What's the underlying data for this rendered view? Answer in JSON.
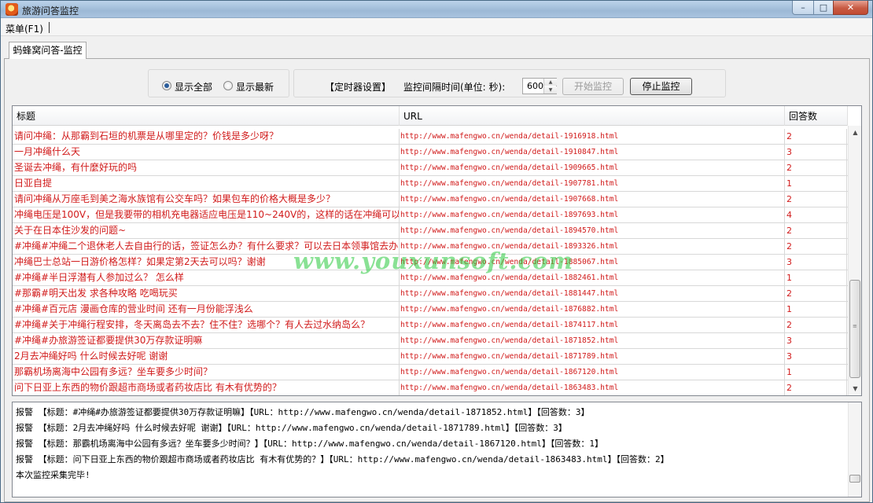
{
  "window": {
    "title": "旅游问答监控",
    "buttons": {
      "minimize": "–",
      "maximize": "□",
      "close": "✕"
    }
  },
  "menu": {
    "items": [
      {
        "label": "菜单(F1)"
      }
    ]
  },
  "tabs": [
    {
      "label": "蚂蜂窝问答-监控",
      "active": true
    }
  ],
  "controls": {
    "display_mode": {
      "options": [
        {
          "label": "显示全部",
          "checked": true
        },
        {
          "label": "显示最新",
          "checked": false
        }
      ]
    },
    "timer_label": "【定时器设置】",
    "interval_label": "监控间隔时间(单位: 秒):",
    "interval_value": "600",
    "start_button": {
      "label": "开始监控",
      "enabled": false
    },
    "stop_button": {
      "label": "停止监控",
      "enabled": true
    }
  },
  "table": {
    "columns": [
      "标题",
      "URL",
      "回答数"
    ],
    "rows": [
      {
        "title": "请问冲绳：从那霸到石垣的机票是从哪里定的？价钱是多少呀？",
        "url": "http://www.mafengwo.cn/wenda/detail-1916918.html",
        "count": "2"
      },
      {
        "title": "一月冲绳什么天",
        "url": "http://www.mafengwo.cn/wenda/detail-1910847.html",
        "count": "3"
      },
      {
        "title": "圣诞去冲绳，有什麼好玩的吗",
        "url": "http://www.mafengwo.cn/wenda/detail-1909665.html",
        "count": "2"
      },
      {
        "title": "日亚自提",
        "url": "http://www.mafengwo.cn/wenda/detail-1907781.html",
        "count": "1"
      },
      {
        "title": "请问冲绳从万座毛到美之海水族馆有公交车吗？如果包车的价格大概是多少？",
        "url": "http://www.mafengwo.cn/wenda/detail-1907668.html",
        "count": "2"
      },
      {
        "title": "冲绳电压是100V，但是我要带的相机充电器适应电压是110~240V的，这样的话在冲绳可以直",
        "url": "http://www.mafengwo.cn/wenda/detail-1897693.html",
        "count": "4"
      },
      {
        "title": "关于在日本住沙发的问题~",
        "url": "http://www.mafengwo.cn/wenda/detail-1894570.html",
        "count": "2"
      },
      {
        "title": "#冲绳#冲绳二个退休老人去自由行的话，签证怎么办？有什么要求？可以去日本领事馆去办",
        "url": "http://www.mafengwo.cn/wenda/detail-1893326.html",
        "count": "2"
      },
      {
        "title": "冲绳巴士总站一日游价格怎样？如果定第2天去可以吗？谢谢",
        "url": "http://www.mafengwo.cn/wenda/detail-1885067.html",
        "count": "3"
      },
      {
        "title": "#冲绳#半日浮潜有人参加过么？ 怎么样",
        "url": "http://www.mafengwo.cn/wenda/detail-1882461.html",
        "count": "1"
      },
      {
        "title": "#那霸#明天出发 求各种攻略 吃喝玩买",
        "url": "http://www.mafengwo.cn/wenda/detail-1881447.html",
        "count": "2"
      },
      {
        "title": "#冲绳#百元店 漫画仓库的营业时间 还有一月份能浮浅么",
        "url": "http://www.mafengwo.cn/wenda/detail-1876882.html",
        "count": "1"
      },
      {
        "title": "#冲绳#关于冲绳行程安排，冬天离岛去不去？住不住？选哪个？有人去过水纳岛么？",
        "url": "http://www.mafengwo.cn/wenda/detail-1874117.html",
        "count": "2"
      },
      {
        "title": "#冲绳#办旅游签证都要提供30万存款证明嘛",
        "url": "http://www.mafengwo.cn/wenda/detail-1871852.html",
        "count": "3"
      },
      {
        "title": "2月去冲绳好吗 什么时候去好呢 谢谢",
        "url": "http://www.mafengwo.cn/wenda/detail-1871789.html",
        "count": "3"
      },
      {
        "title": "那霸机场离海中公园有多远？坐车要多少时间？",
        "url": "http://www.mafengwo.cn/wenda/detail-1867120.html",
        "count": "1"
      },
      {
        "title": "问下日亚上东西的物价跟超市商场或者药妆店比 有木有优势的？",
        "url": "http://www.mafengwo.cn/wenda/detail-1863483.html",
        "count": "2"
      }
    ]
  },
  "log": {
    "lines": [
      "报警 【标题：#冲绳#办旅游签证都要提供30万存款证明嘛】【URL：http://www.mafengwo.cn/wenda/detail-1871852.html】【回答数：3】",
      "报警 【标题：2月去冲绳好吗 什么时候去好呢 谢谢】【URL：http://www.mafengwo.cn/wenda/detail-1871789.html】【回答数：3】",
      "报警 【标题：那霸机场离海中公园有多远？坐车要多少时间？】【URL：http://www.mafengwo.cn/wenda/detail-1867120.html】【回答数：1】",
      "报警 【标题：问下日亚上东西的物价跟超市商场或者药妆店比 有木有优势的？】【URL：http://www.mafengwo.cn/wenda/detail-1863483.html】【回答数：2】",
      "本次监控采集完毕!"
    ]
  },
  "watermark": "www.youxunsoft.com",
  "colors": {
    "row_text": "#d11b1b",
    "watermark": "#28c83c",
    "titlebar": "#9db9d6"
  }
}
